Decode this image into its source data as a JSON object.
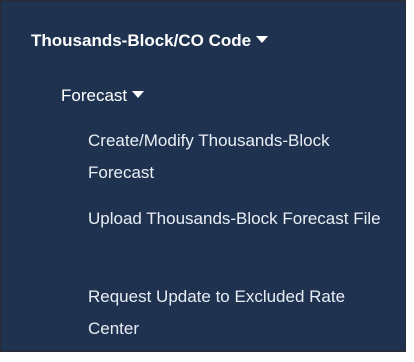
{
  "nav": {
    "section_label": "Thousands-Block/CO Code",
    "subsection_label": "Forecast",
    "links": [
      {
        "label": "Create/Modify Thousands-Block Forecast"
      },
      {
        "label": "Upload Thousands-Block Forecast File"
      },
      {
        "label": "Request Update to Excluded Rate Center"
      }
    ]
  },
  "colors": {
    "panel_background": "#1f3350",
    "text": "#ffffff",
    "link_text": "#e9eef5"
  },
  "icons": {
    "section_toggle": "caret-down-icon",
    "subsection_toggle": "caret-down-icon"
  }
}
